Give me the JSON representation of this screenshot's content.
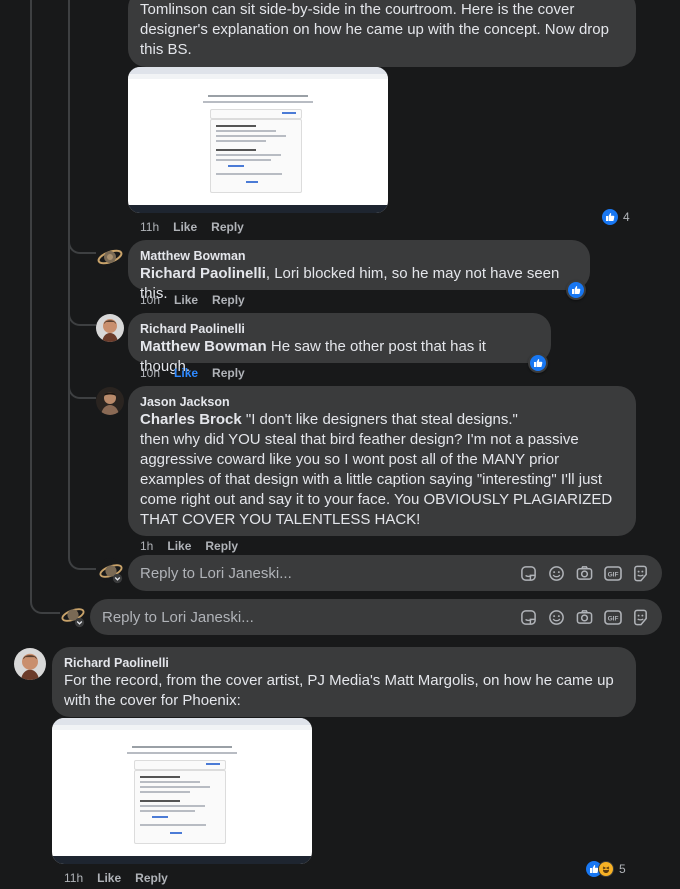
{
  "comments": [
    {
      "id": "first",
      "lines": [
        "Tomlinson can sit side-by-side in the courtroom. Here is the cover",
        "designer's explanation on how he came up with the concept. Now drop",
        "this BS."
      ],
      "time": "11h",
      "like": "Like",
      "reply": "Reply",
      "reaction_count": "4"
    },
    {
      "id": "matthew",
      "author": "Matthew Bowman",
      "mention": "Richard Paolinelli",
      "text": ", Lori blocked him, so he may not have seen this.",
      "time": "10h",
      "like": "Like",
      "reply": "Reply"
    },
    {
      "id": "richard1",
      "author": "Richard Paolinelli",
      "mention": "Matthew Bowman",
      "text": " He saw the other post that has it though.",
      "time": "10h",
      "like": "Like",
      "reply": "Reply"
    },
    {
      "id": "jason",
      "author": "Jason Jackson",
      "mention": "Charles Brock",
      "first_line": " \"I don't like designers that steal designs.\"",
      "lines": [
        "then why did YOU steal that bird feather design? I'm not a passive",
        "aggressive coward like you so I wont post all of the MANY prior",
        "examples of that design with a little caption saying \"interesting\" I'll just",
        "come right out and say it to your face. You OBVIOUSLY PLAGIARIZED",
        "THAT COVER YOU TALENTLESS HACK!"
      ],
      "time": "1h",
      "like": "Like",
      "reply": "Reply"
    },
    {
      "id": "richard2",
      "author": "Richard Paolinelli",
      "lines": [
        "For the record, from the cover artist, PJ Media's Matt Margolis, on how he came up",
        "with the cover for Phoenix:"
      ],
      "time": "11h",
      "like": "Like",
      "reply": "Reply",
      "reaction_count": "5"
    }
  ],
  "reply_boxes": [
    {
      "placeholder": "Reply to Lori Janeski..."
    },
    {
      "placeholder": "Reply to Lori Janeski..."
    }
  ],
  "icons": [
    "like-icon",
    "haha-icon",
    "sticker-icon",
    "emoji-icon",
    "camera-icon",
    "gif-icon",
    "avatar-sticker-icon"
  ],
  "gif_label": "GIF",
  "colors": {
    "background": "#18191a",
    "bubble": "#3a3b3c",
    "text": "#e4e6eb",
    "meta": "#b0b3b8",
    "like_blue": "#2e89ff"
  }
}
